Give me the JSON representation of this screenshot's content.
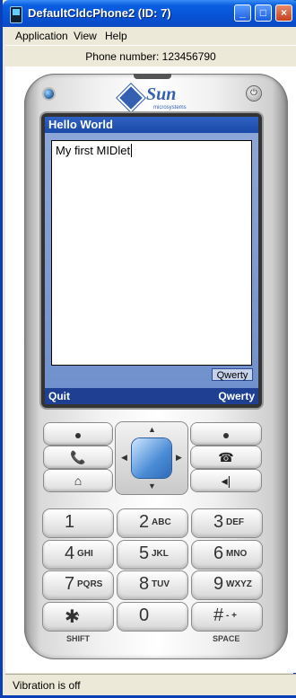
{
  "window": {
    "title": "DefaultCldcPhone2 (ID: 7)",
    "min": "_",
    "max": "□",
    "close": "×"
  },
  "menu": {
    "items": [
      "Application",
      "View",
      "Help"
    ]
  },
  "phone_number": "Phone number:  123456790",
  "status": "Vibration is off",
  "logo": {
    "brand": "Sun",
    "sub": "microsystems"
  },
  "midlet": {
    "title": "Hello World",
    "text": "My first MIDlet",
    "input_mode": "Qwerty",
    "soft_left": "Quit",
    "soft_right": "Qwerty"
  },
  "keypad": {
    "keys": [
      {
        "num": "1",
        "letters": ""
      },
      {
        "num": "2",
        "letters": "ABC"
      },
      {
        "num": "3",
        "letters": "DEF"
      },
      {
        "num": "4",
        "letters": "GHI"
      },
      {
        "num": "5",
        "letters": "JKL"
      },
      {
        "num": "6",
        "letters": "MNO"
      },
      {
        "num": "7",
        "letters": "PQRS"
      },
      {
        "num": "8",
        "letters": "TUV"
      },
      {
        "num": "9",
        "letters": "WXYZ"
      },
      {
        "num": "✱",
        "letters": "·"
      },
      {
        "num": "0",
        "letters": ""
      },
      {
        "num": "#",
        "letters": "- +"
      }
    ],
    "shift": "SHIFT",
    "space": "SPACE"
  },
  "colors": {
    "titlebar": "#0753d6",
    "screen_title": "#1a49a8",
    "softbar": "#1e3f92"
  }
}
